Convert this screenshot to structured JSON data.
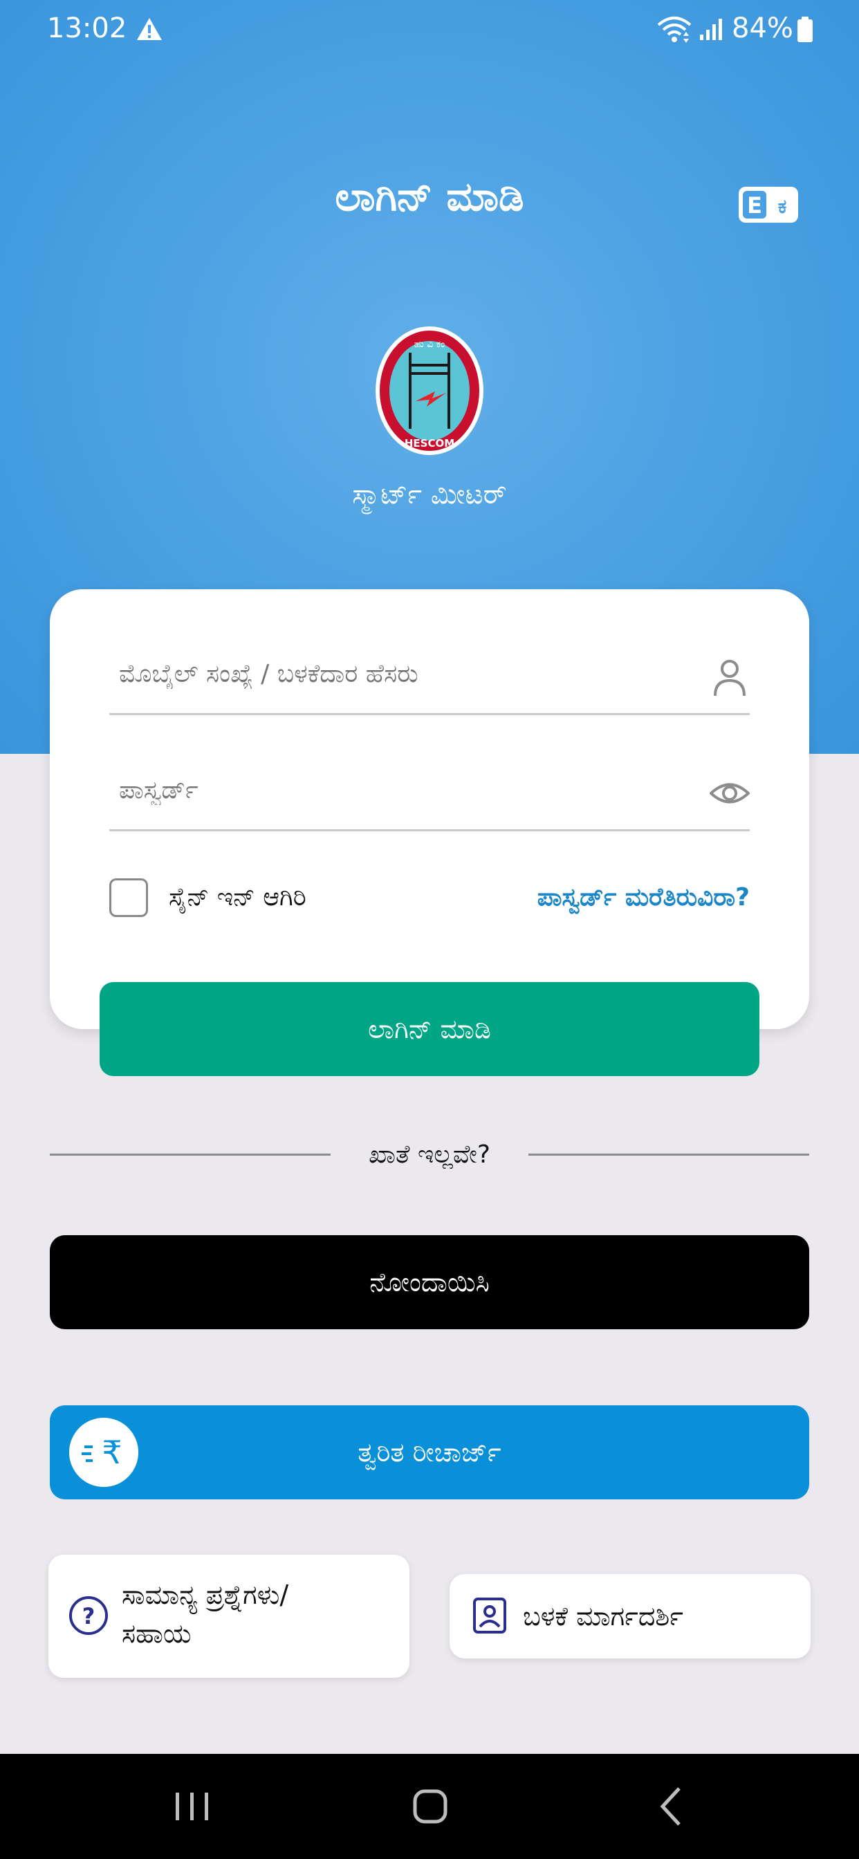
{
  "status_bar": {
    "time": "13:02",
    "battery": "84%"
  },
  "header": {
    "title": "ಲಾಗಿನ್ ಮಾಡಿ",
    "subtitle": "ಸ್ಮಾರ್ಟ್ ಮೀಟರ್",
    "language_toggle_icon": "language-toggle-icon",
    "logo_text": "HESCOM"
  },
  "login_form": {
    "username_placeholder": "ಮೊಬೈಲ್ ಸಂಖ್ಯೆ / ಬಳಕೆದಾರ ಹೆಸರು",
    "password_placeholder": "ಪಾಸ್ವರ್ಡ್",
    "remember_label": "ಸೈನ್ ಇನ್ ಆಗಿರಿ",
    "remember_checked": false,
    "forgot_label": "ಪಾಸ್ವರ್ಡ್ ಮರೆತಿರುವಿರಾ?",
    "login_label": "ಲಾಗಿನ್ ಮಾಡಿ"
  },
  "signup": {
    "divider_text": "ಖಾತೆ ಇಲ್ಲವೇ?",
    "register_label": "ನೋಂದಾಯಿಸಿ"
  },
  "quick_recharge": {
    "label": "ತ್ವರಿತ ರೀಚಾರ್ಜ್",
    "icon": "rupee-fast-icon"
  },
  "help": {
    "faq_line1": "ಸಾಮಾನ್ಯ ಪ್ರಶ್ನೆಗಳು/",
    "faq_line2": "ಸಹಾಯ",
    "guide_label": "ಬಳಕೆ ಮಾರ್ಗದರ್ಶಿ"
  },
  "colors": {
    "header_blue": "#4ca2e3",
    "login_green": "#00a585",
    "recharge_blue": "#0a90d8",
    "link_blue": "#1a86c8"
  }
}
